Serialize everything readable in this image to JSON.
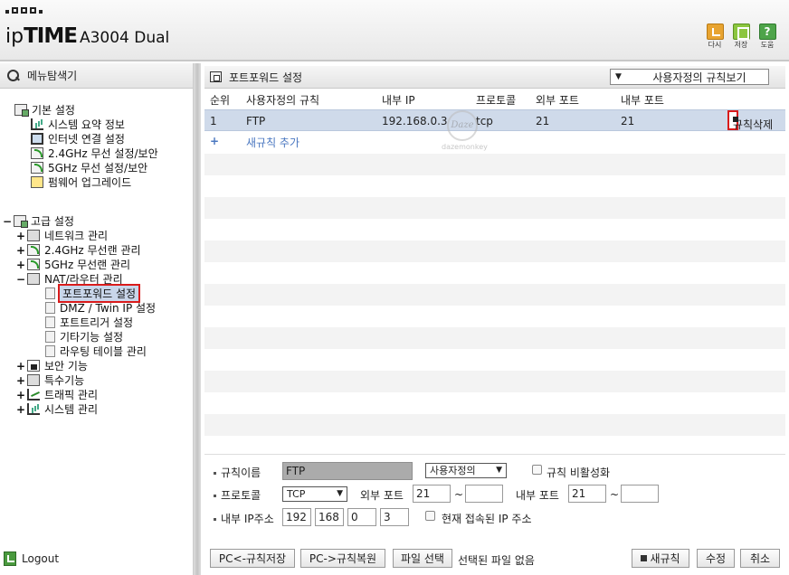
{
  "header": {
    "brand_prefix": "ip",
    "brand_main": "TIME",
    "model": "A3004 Dual",
    "buttons": [
      {
        "label": "다시",
        "icon": "back-icon"
      },
      {
        "label": "저장",
        "icon": "save-icon"
      },
      {
        "label": "도움",
        "icon": "help-icon",
        "glyph": "?"
      }
    ]
  },
  "sidebar": {
    "title": "메뉴탐색기",
    "basic": {
      "label": "기본 설정",
      "items": [
        "시스템 요약 정보",
        "인터넷 연결 설정",
        "2.4GHz 무선 설정/보안",
        "5GHz 무선 설정/보안",
        "펌웨어 업그레이드"
      ]
    },
    "advanced": {
      "label": "고급 설정",
      "items": [
        "네트워크 관리",
        "2.4GHz 무선랜 관리",
        "5GHz 무선랜 관리",
        "NAT/라우터 관리"
      ],
      "nat_children": [
        "포트포워드 설정",
        "DMZ / Twin IP 설정",
        "포트트리거 설정",
        "기타기능 설정",
        "라우팅 테이블 관리"
      ],
      "after": [
        "보안 기능",
        "특수기능",
        "트래픽 관리",
        "시스템 관리"
      ]
    },
    "expand_plus": "+",
    "expand_minus": "−",
    "logout": "Logout"
  },
  "main": {
    "title": "포트포워드 설정",
    "view_select": {
      "arrow": "▼",
      "value": "사용자정의 규칙보기"
    },
    "columns": [
      "순위",
      "사용자정의 규칙",
      "내부 IP",
      "프로토콜",
      "외부 포트",
      "내부 포트"
    ],
    "rows": [
      {
        "rank": "1",
        "rule": "FTP",
        "ip": "192.168.0.3",
        "protocol": "tcp",
        "ext_port": "21",
        "int_port": "21"
      }
    ],
    "delete_label": "규칙삭제",
    "add_plus": "+",
    "add_label": "새규칙 추가",
    "watermark": {
      "mark": "Daze",
      "text": "dazemonkey"
    }
  },
  "form": {
    "name_label": "규칙이름",
    "name_value": "FTP",
    "type_select": "사용자정의",
    "disable_label": "규칙 비활성화",
    "protocol_label": "프로토콜",
    "protocol_value": "TCP",
    "ext_port_label": "외부 포트",
    "ext_port_from": "21",
    "ext_port_to": "",
    "int_port_label": "내부 포트",
    "int_port_from": "21",
    "int_port_to": "",
    "tilde": "~",
    "ip_label": "내부 IP주소",
    "ip": [
      "192",
      "168",
      "0",
      "3"
    ],
    "current_ip_label": "현재 접속된 IP 주소",
    "arrow": "▼"
  },
  "buttons": {
    "pc_save": "PC<-규칙저장",
    "pc_restore": "PC->규칙복원",
    "file_select": "파일 선택",
    "no_file": "선택된 파일 없음",
    "new_rule": "새규칙",
    "modify": "수정",
    "cancel": "취소"
  }
}
